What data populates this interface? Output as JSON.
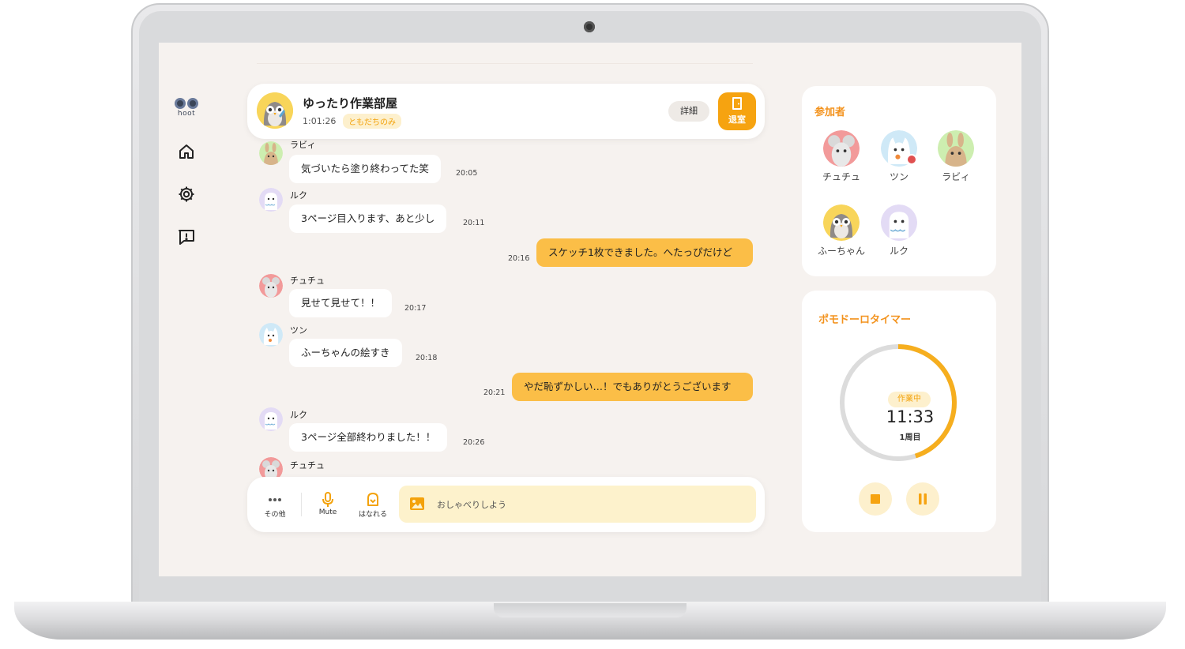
{
  "app": {
    "logo_text": "hoot"
  },
  "nav": [
    {
      "name": "home-icon"
    },
    {
      "name": "gear-icon"
    },
    {
      "name": "report-icon"
    }
  ],
  "room": {
    "title": "ゆったり作業部屋",
    "elapsed": "1:01:26",
    "visibility_tag": "ともだちのみ",
    "detail_label": "詳細",
    "exit_label": "退室"
  },
  "messages": [
    {
      "name": "ラビィ",
      "text": "気づいたら塗り終わってた笑",
      "time": "20:05",
      "mine": false,
      "avatar": "rabbit"
    },
    {
      "name": "ルク",
      "text": "3ページ目入ります、あと少し",
      "time": "20:11",
      "mine": false,
      "avatar": "ghost"
    },
    {
      "name": "",
      "text": "スケッチ1枚できました。へたっぴだけど",
      "time": "20:16",
      "mine": true
    },
    {
      "name": "チュチュ",
      "text": "見せて見せて！！",
      "time": "20:17",
      "mine": false,
      "avatar": "mouse"
    },
    {
      "name": "ツン",
      "text": "ふーちゃんの絵すき",
      "time": "20:18",
      "mine": false,
      "avatar": "cat"
    },
    {
      "name": "",
      "text": "やだ恥ずかしい…！でもありがとうございます",
      "time": "20:21",
      "mine": true
    },
    {
      "name": "ルク",
      "text": "3ページ全部終わりました！！",
      "time": "20:26",
      "mine": false,
      "avatar": "ghost"
    },
    {
      "name": "チュチュ",
      "text": "",
      "time": "",
      "mine": false,
      "avatar": "mouse"
    }
  ],
  "composer": {
    "other_label": "その他",
    "mute_label": "Mute",
    "leave_label": "はなれる",
    "placeholder": "おしゃべりしよう"
  },
  "participants": {
    "title": "参加者",
    "members": [
      {
        "name": "チュチュ",
        "avatar": "mouse",
        "muted": false
      },
      {
        "name": "ツン",
        "avatar": "cat",
        "muted": true
      },
      {
        "name": "ラビィ",
        "avatar": "rabbit",
        "muted": false
      },
      {
        "name": "ふーちゃん",
        "avatar": "owl",
        "muted": false
      },
      {
        "name": "ルク",
        "avatar": "ghost",
        "muted": false
      }
    ]
  },
  "timer": {
    "title": "ポモドーロタイマー",
    "state": "作業中",
    "remaining": "11:33",
    "round": "1周目",
    "progress_fraction": 0.45
  },
  "colors": {
    "accent": "#f6a310",
    "bubble_mine": "#fbbe47",
    "background": "#f6f2ef"
  }
}
